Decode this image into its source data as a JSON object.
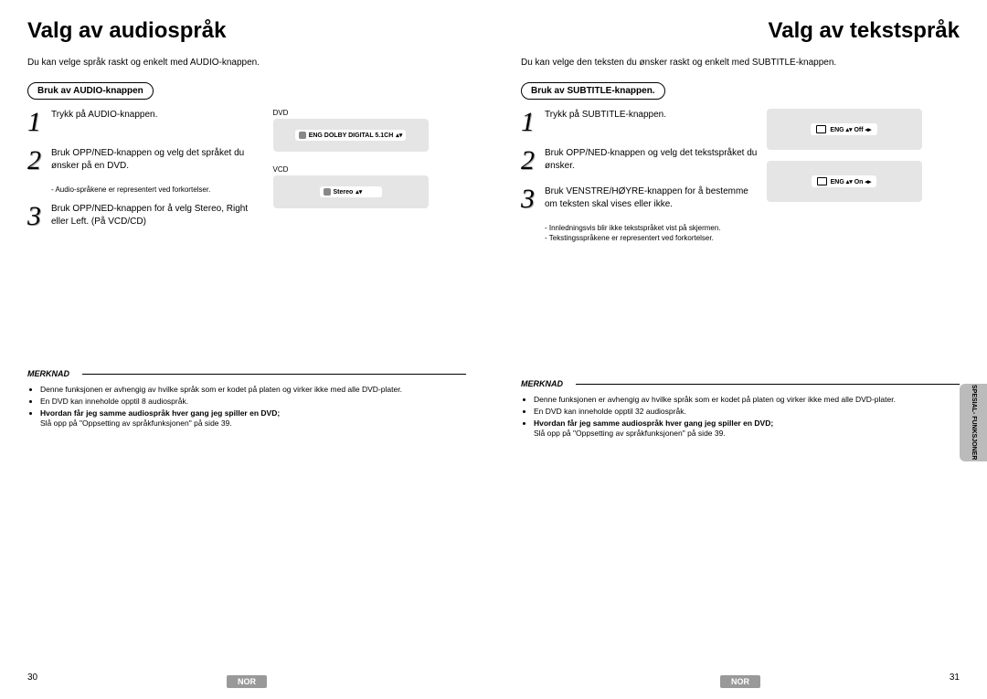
{
  "left": {
    "title": "Valg av audiospråk",
    "intro": "Du kan velge språk raskt og enkelt med AUDIO-knappen.",
    "pill": "Bruk av AUDIO-knappen",
    "steps": [
      {
        "num": "1",
        "text": "Trykk på AUDIO-knappen."
      },
      {
        "num": "2",
        "text": "Bruk OPP/NED-knappen og velg det språket du ønsker på en DVD."
      },
      {
        "num": "3",
        "text": "Bruk OPP/NED-knappen for å velg Stereo, Right eller Left. (På VCD/CD)"
      }
    ],
    "sub_after_2": "- Audio-språkene er representert ved forkortelser.",
    "vis_dvd_label": "DVD",
    "vis_dvd_text": "ENG  DOLBY  DIGITAL  5.1CH",
    "vis_vcd_label": "VCD",
    "vis_vcd_text": "Stereo",
    "note_label": "MERKNAD",
    "notes": [
      "Denne funksjonen er avhengig av hvilke språk som er kodet på platen og virker ikke med alle DVD-plater.",
      "En DVD kan inneholde opptil 8 audiospråk.",
      "Hvordan får jeg samme audiospråk hver gang jeg spiller en DVD;"
    ],
    "note_sub": "Slå opp på \"Oppsetting av språkfunksjonen\" på side 39.",
    "page_num": "30",
    "nor": "NOR"
  },
  "right": {
    "title": "Valg av tekstspråk",
    "intro": "Du kan velge den teksten du ønsker raskt og enkelt med SUBTITLE-knappen.",
    "pill": "Bruk av SUBTITLE-knappen.",
    "steps": [
      {
        "num": "1",
        "text": "Trykk på SUBTITLE-knappen."
      },
      {
        "num": "2",
        "text": "Bruk OPP/NED-knappen og velg det tekstspråket du ønsker."
      },
      {
        "num": "3",
        "text": "Bruk VENSTRE/HØYRE-knappen for å bestemme om teksten skal vises eller ikke."
      }
    ],
    "subs_after_3": [
      "- Innledningsvis blir ikke tekstspråket vist på skjermen.",
      "- Tekstingsspråkene er representert ved forkortelser."
    ],
    "vis_off": "ENG ▴▾  Off  ◂▸",
    "vis_on": "ENG ▴▾  On  ◂▸",
    "note_label": "MERKNAD",
    "notes": [
      "Denne funksjonen er avhengig av hvilke språk som er kodet på platen og virker ikke med alle DVD-plater.",
      "En DVD kan inneholde opptil 32 audiospråk.",
      "Hvordan får jeg samme audiospråk hver gang jeg spiller en DVD;"
    ],
    "note_sub": "Slå opp på \"Oppsetting av språkfunksjonen\" på side 39.",
    "page_num": "31",
    "nor": "NOR",
    "side_tab": "SPESIAL-\nFUNKSJONER"
  }
}
